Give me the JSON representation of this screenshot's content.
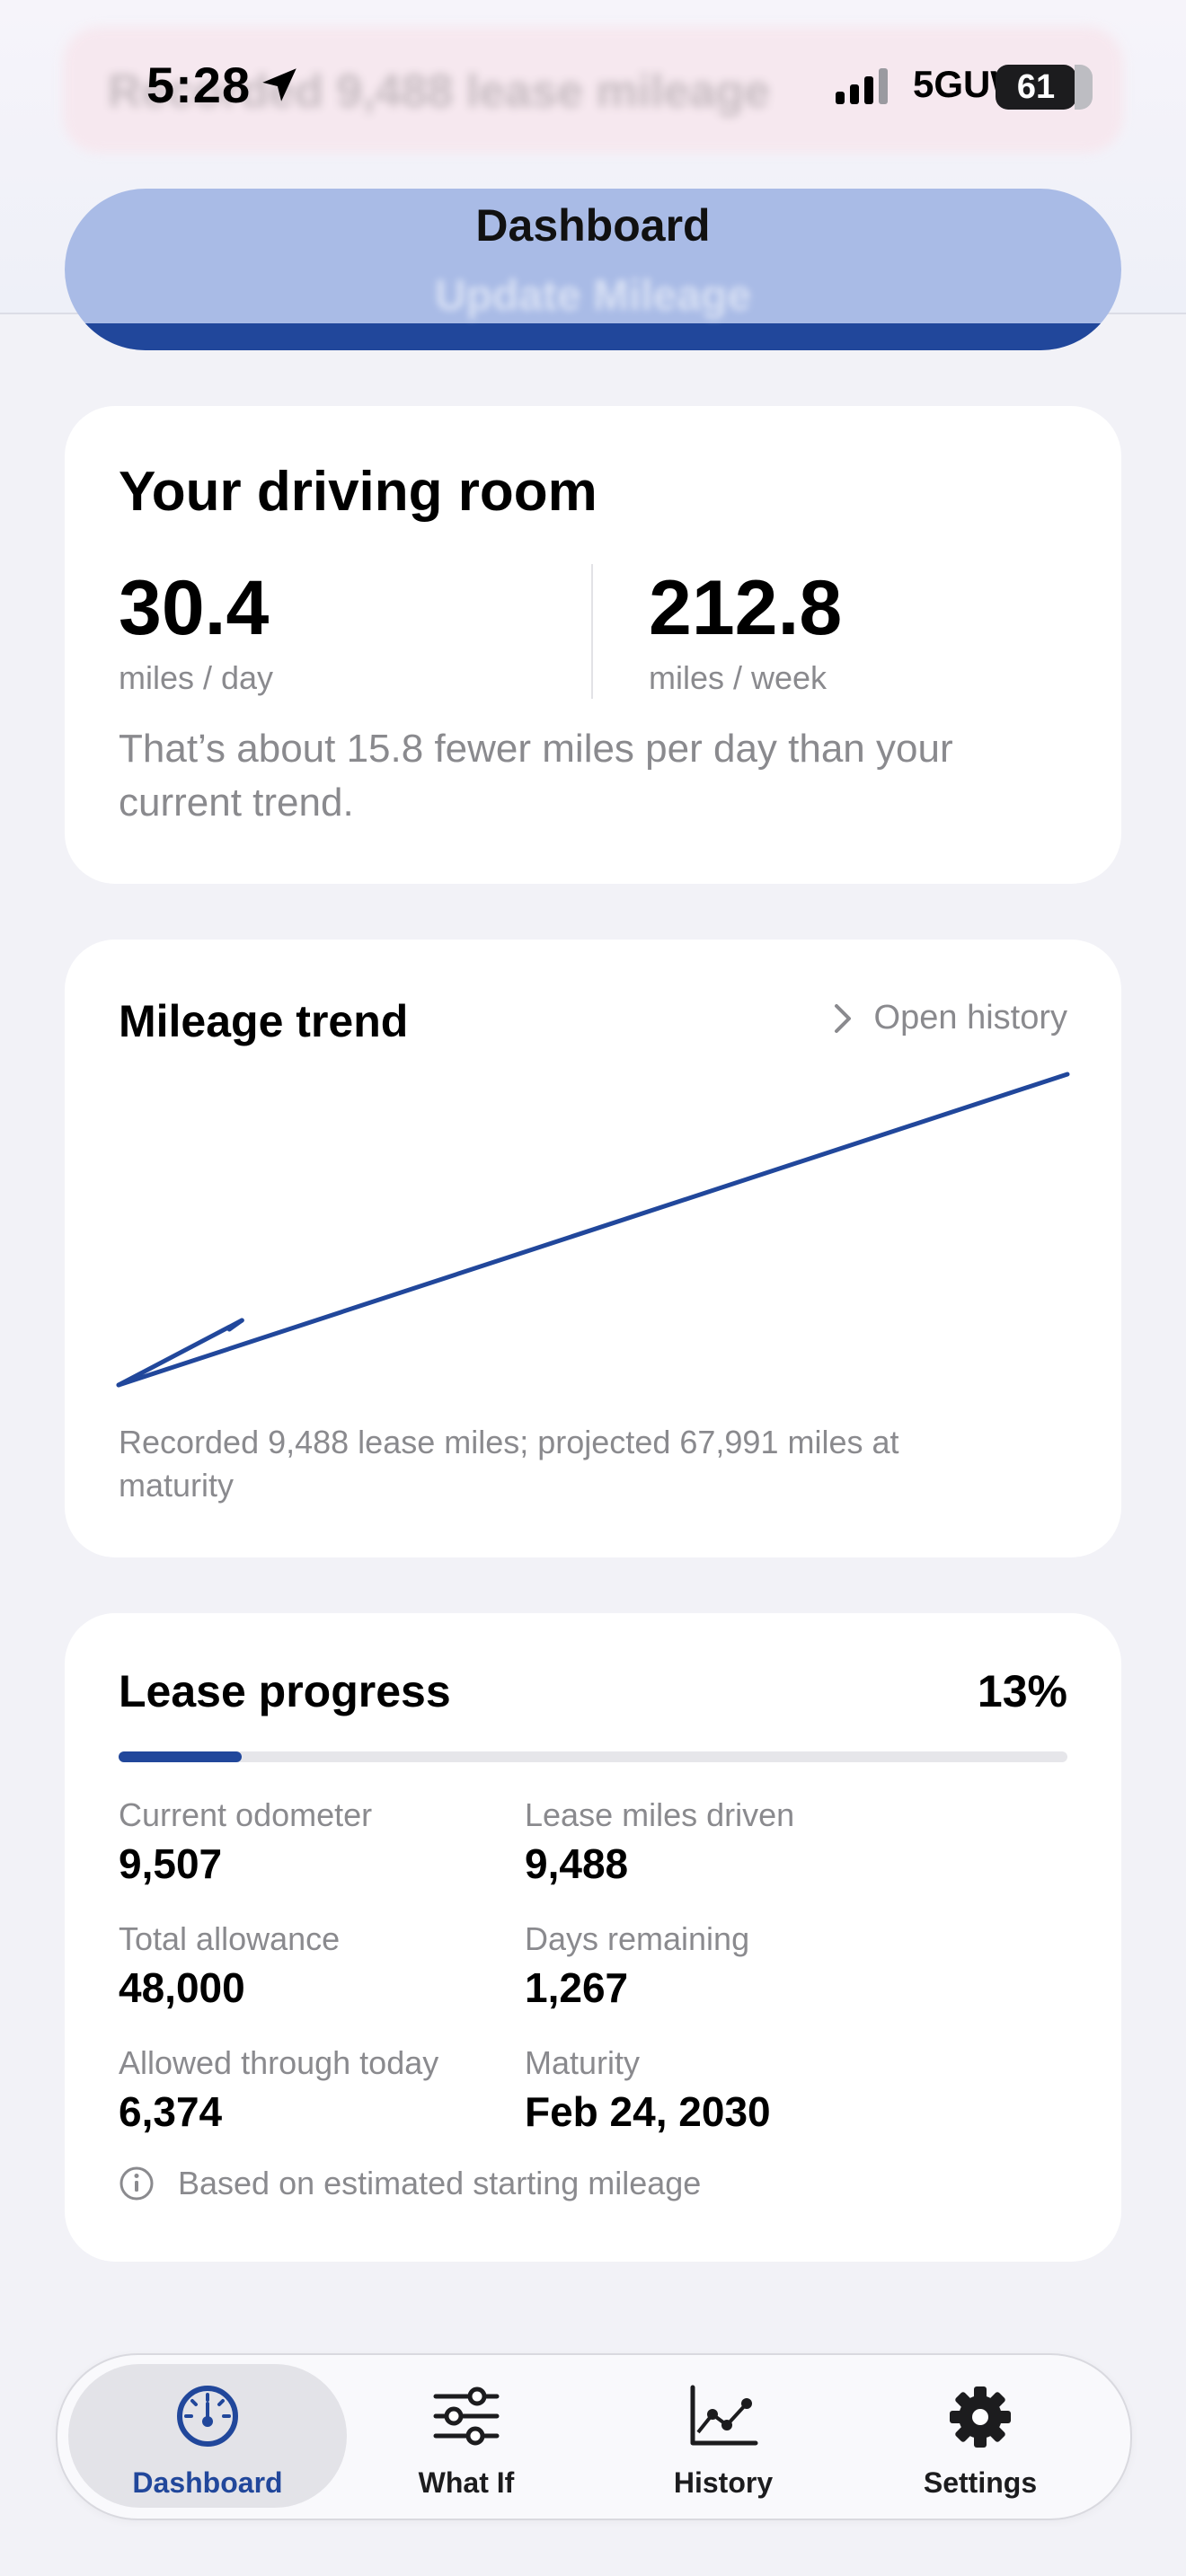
{
  "status_bar": {
    "time": "5:28",
    "network": "5GUW",
    "battery": "61"
  },
  "top_banner": {
    "obscured_text": "Recorded 9,488 lease mileage",
    "update_button_label": "Update Mileage"
  },
  "nav": {
    "title": "Dashboard"
  },
  "driving_room": {
    "title": "Your driving room",
    "per_day_value": "30.4",
    "per_day_unit": "miles / day",
    "per_week_value": "212.8",
    "per_week_unit": "miles / week",
    "note": "That’s about 15.8 fewer miles per day than your current trend."
  },
  "trend": {
    "title": "Mileage trend",
    "open_history": "Open history",
    "caption": "Recorded 9,488 lease miles; projected 67,991 miles at maturity"
  },
  "chart_data": {
    "type": "line",
    "title": "Mileage trend",
    "xlabel": "",
    "ylabel": "",
    "grid": false,
    "series": [
      {
        "values": [
          {
            "x": 0.0,
            "y": 0
          },
          {
            "x": 0.13,
            "y": 9488
          },
          {
            "x": 1.0,
            "y": 67991
          }
        ]
      }
    ],
    "notes_on_axes": "no axis ticks shown; x is fraction of lease term elapsed, y is lease miles",
    "ylim": [
      0,
      67991
    ]
  },
  "lease": {
    "title": "Lease progress",
    "percent_label": "13%",
    "progress_fraction": 0.13,
    "stats": [
      {
        "label": "Current odometer",
        "value": "9,507"
      },
      {
        "label": "Lease miles driven",
        "value": "9,488"
      },
      {
        "label": "Total allowance",
        "value": "48,000"
      },
      {
        "label": "Days remaining",
        "value": "1,267"
      },
      {
        "label": "Allowed through today",
        "value": "6,374"
      },
      {
        "label": "Maturity",
        "value": "Feb 24, 2030"
      }
    ],
    "info": "Based on estimated starting mileage"
  },
  "tabbar": {
    "tabs": [
      {
        "label": "Dashboard",
        "icon": "gauge-icon",
        "active": true
      },
      {
        "label": "What If",
        "icon": "sliders-icon",
        "active": false
      },
      {
        "label": "History",
        "icon": "chart-icon",
        "active": false
      },
      {
        "label": "Settings",
        "icon": "gear-icon",
        "active": false
      }
    ]
  },
  "colors": {
    "accent": "#21479b",
    "background": "#f2f2f7",
    "card": "#ffffff",
    "secondary_text": "#8a8a8e"
  }
}
